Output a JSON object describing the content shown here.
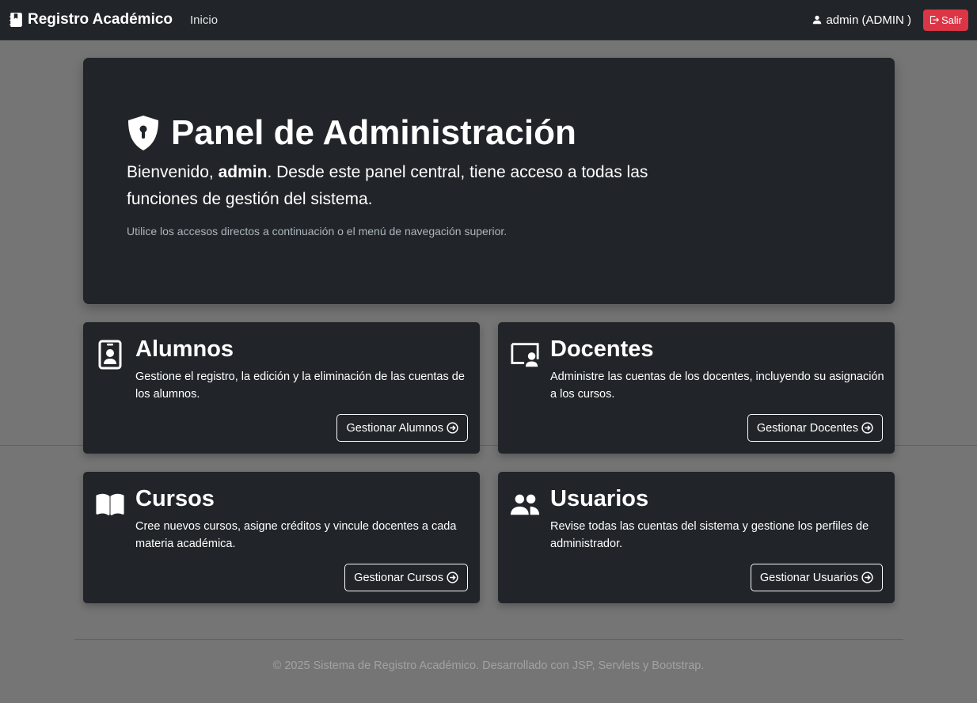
{
  "navbar": {
    "brand": "Registro Académico",
    "brand_icon": "journal-bookmark-icon",
    "links": [
      {
        "label": "Inicio"
      }
    ],
    "user_label": "admin (ADMIN )",
    "user_icon": "person-icon",
    "logout_label": "Salir",
    "logout_icon": "box-arrow-right-icon"
  },
  "hero": {
    "icon": "shield-lock-icon",
    "title": "Panel de Administración",
    "lead_prefix": "Bienvenido,",
    "lead_user": "admin",
    "lead_suffix": ". Desde este panel central, tiene acceso a todas las funciones de gestión del sistema.",
    "note": "Utilice los accesos directos a continuación o el menú de navegación superior."
  },
  "cards": [
    {
      "icon": "person-badge-icon",
      "title": "Alumnos",
      "description": "Gestione el registro, la edición y la eliminación de las cuentas de los alumnos.",
      "button": "Gestionar Alumnos"
    },
    {
      "icon": "person-video-icon",
      "title": "Docentes",
      "description": "Administre las cuentas de los docentes, incluyendo su asignación a los cursos.",
      "button": "Gestionar Docentes"
    },
    {
      "icon": "book-icon",
      "title": "Cursos",
      "description": "Cree nuevos cursos, asigne créditos y vincule docentes a cada materia académica.",
      "button": "Gestionar Cursos"
    },
    {
      "icon": "people-icon",
      "title": "Usuarios",
      "description": "Revise todas las cuentas del sistema y gestione los perfiles de administrador.",
      "button": "Gestionar Usuarios"
    }
  ],
  "footer": {
    "text": "© 2025 Sistema de Registro Académico. Desarrollado con JSP, Servlets y Bootstrap."
  },
  "colors": {
    "navbar_bg": "#212529",
    "page_bg": "#757575",
    "danger": "#dc3545",
    "card_bg": "#212529"
  }
}
